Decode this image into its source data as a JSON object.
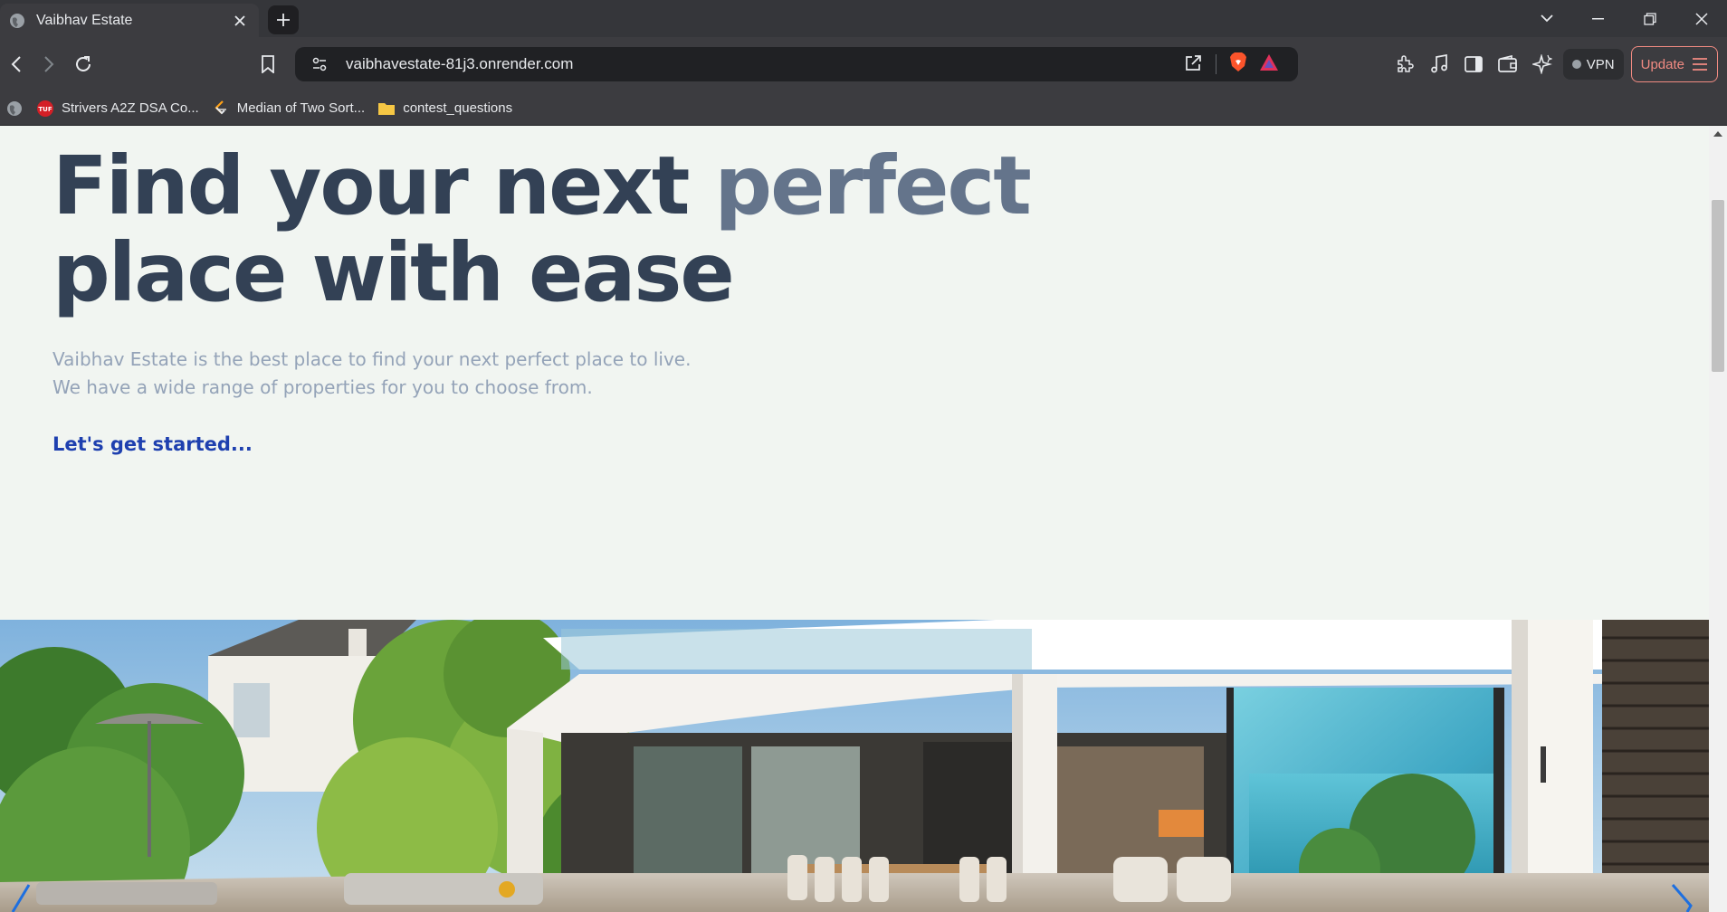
{
  "browser": {
    "tab": {
      "title": "Vaibhav Estate"
    },
    "address_bar": {
      "url": "vaibhavestate-81j3.onrender.com"
    },
    "vpn_label": "VPN",
    "update_label": "Update",
    "bookmarks": [
      {
        "label": "Strivers A2Z DSA Co...",
        "icon": "tuf-icon"
      },
      {
        "label": "Median of Two Sort...",
        "icon": "leetcode-icon"
      },
      {
        "label": "contest_questions",
        "icon": "folder-icon"
      }
    ]
  },
  "page": {
    "hero": {
      "title_part1": "Find your next ",
      "title_accent": "perfect",
      "title_part2": "place with ease",
      "description_line1": "Vaibhav Estate is the best place to find your next perfect place to live.",
      "description_line2": "We have a wide range of properties for you to choose from.",
      "cta_label": "Let's get started..."
    },
    "carousel": {
      "image": "modern-villa-with-pool-photo"
    }
  },
  "colors": {
    "title": "#334155",
    "accent": "#64748b",
    "description": "#94a3b8",
    "cta": "#1e40af",
    "page_bg": "#f1f5f1"
  }
}
